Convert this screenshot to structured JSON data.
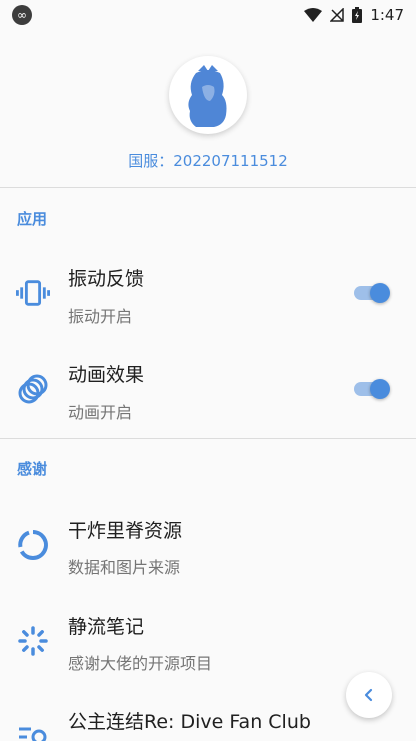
{
  "status_bar": {
    "time": "1:47",
    "app_icon": "infinity-icon",
    "icons": [
      "wifi-icon",
      "no-signal-icon",
      "battery-charging-icon"
    ]
  },
  "header": {
    "top_text": "... .. ... . ... . ..",
    "avatar_icon": "character-avatar-icon",
    "server_label": "国服：202207111512"
  },
  "sections": {
    "app": {
      "title": "应用",
      "items": [
        {
          "title": "振动反馈",
          "subtitle": "振动开启",
          "icon": "vibration-icon",
          "toggle_on": true
        },
        {
          "title": "动画效果",
          "subtitle": "动画开启",
          "icon": "animation-rings-icon",
          "toggle_on": true
        }
      ]
    },
    "thanks": {
      "title": "感谢",
      "items": [
        {
          "title": "干炸里脊资源",
          "subtitle": "数据和图片来源",
          "icon": "progress-ring-icon"
        },
        {
          "title": "静流笔记",
          "subtitle": "感谢大佬的开源项目",
          "icon": "loading-dots-icon"
        },
        {
          "title": "公主连结Re: Dive Fan Club",
          "icon": "search-list-icon"
        }
      ]
    }
  },
  "fab": {
    "icon": "chevron-left-icon"
  },
  "colors": {
    "accent": "#4a8cdd",
    "accent_light": "#9ebfe9",
    "text_primary": "#202020",
    "text_secondary": "#757575"
  }
}
